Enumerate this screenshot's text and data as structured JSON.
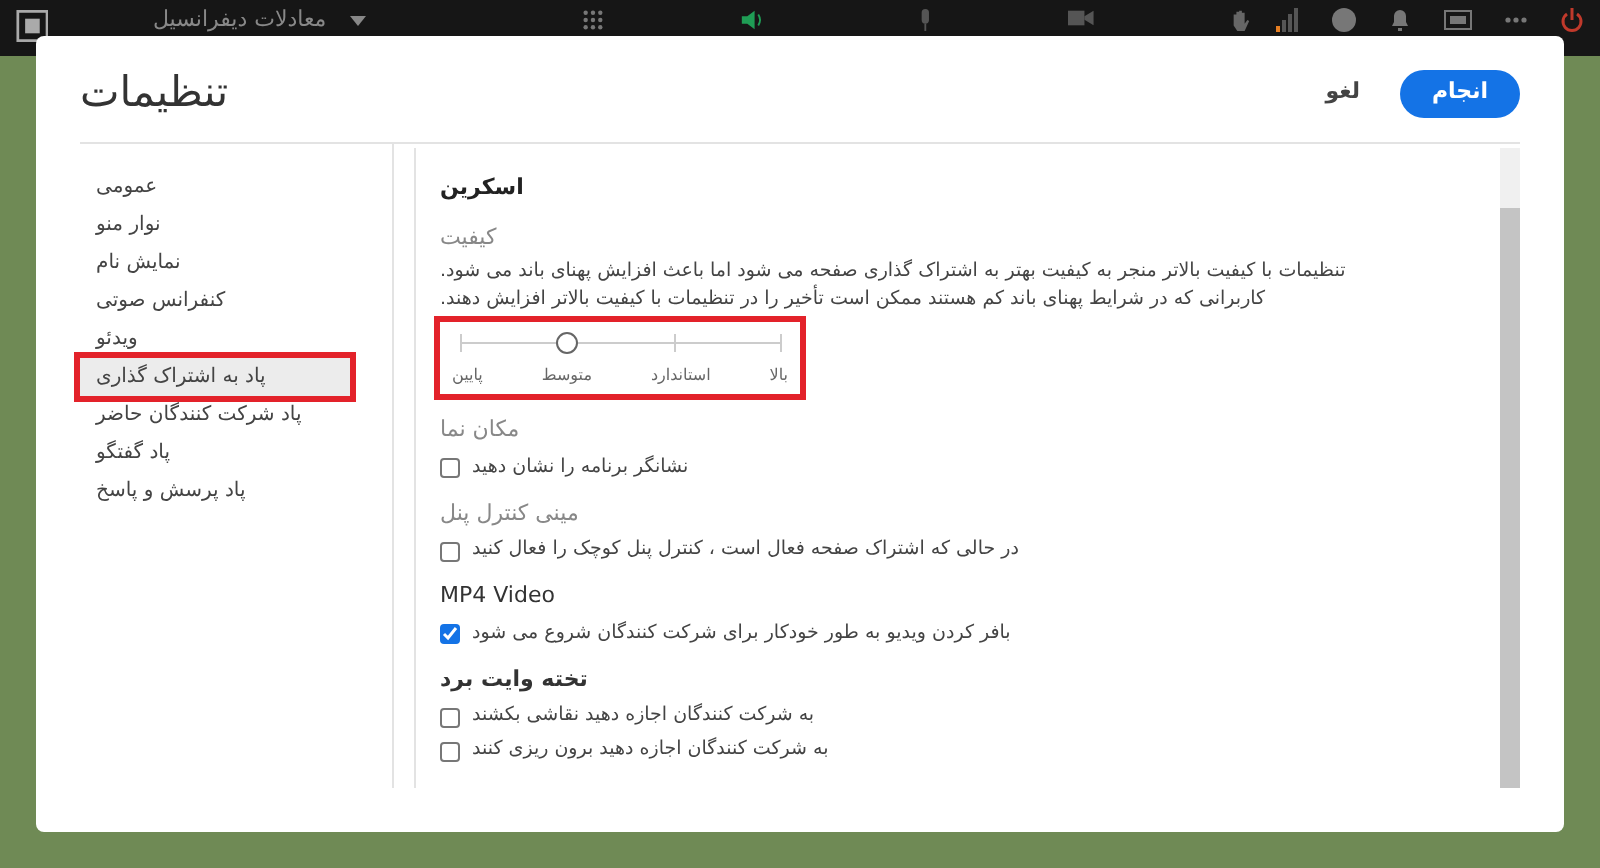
{
  "top_bar": {
    "meeting_title": "معادلات دیفرانسیل"
  },
  "dialog": {
    "title": "تنظیمات",
    "buttons": [
      {
        "label": "انجام",
        "kind": "primary"
      },
      {
        "label": "لغو",
        "kind": "plain"
      }
    ]
  },
  "sidebar": {
    "items": [
      {
        "label": "عمومی",
        "selected": false,
        "highlighted": false
      },
      {
        "label": "نوار منو",
        "selected": false,
        "highlighted": false
      },
      {
        "label": "نمایش نام",
        "selected": false,
        "highlighted": false
      },
      {
        "label": "کنفرانس صوتی",
        "selected": false,
        "highlighted": false
      },
      {
        "label": "ویدئو",
        "selected": false,
        "highlighted": false
      },
      {
        "label": "پاد به اشتراک گذاری",
        "selected": true,
        "highlighted": true
      },
      {
        "label": "پاد شرکت کنندگان حاضر",
        "selected": false,
        "highlighted": false
      },
      {
        "label": "پاد گفتگو",
        "selected": false,
        "highlighted": false
      },
      {
        "label": "پاد پرسش و پاسخ",
        "selected": false,
        "highlighted": false
      }
    ]
  },
  "content": {
    "heading": "اسکرین",
    "sections": [
      {
        "kind": "slider",
        "title": "کیفیت",
        "muted": true,
        "bold": false,
        "description": [
          "تنظیمات با کیفیت بالاتر منجر به کیفیت بهتر به اشتراک گذاری صفحه می شود اما باعث افزایش پهنای باند می شود.",
          "کاربرانی که در شرایط پهنای باند کم هستند ممکن است تأخیر را در تنظیمات با کیفیت بالاتر افزایش دهند."
        ],
        "slider": {
          "highlighted": true,
          "level": 0.333,
          "stops": [
            "بالا",
            "استاندارد",
            "متوسط",
            "پایین"
          ]
        }
      },
      {
        "kind": "checkboxes",
        "title": "مکان نما",
        "muted": true,
        "bold": false,
        "options": [
          {
            "label": "نشانگر برنامه را نشان دهید",
            "checked": false
          }
        ]
      },
      {
        "kind": "checkboxes",
        "title": "مینی کنترل پنل",
        "muted": true,
        "bold": false,
        "options": [
          {
            "label": "در حالی که اشتراک صفحه فعال است ، کنترل پنل کوچک را فعال کنید",
            "checked": false
          }
        ]
      },
      {
        "kind": "checkboxes",
        "title": "MP4 Video",
        "muted": false,
        "bold": false,
        "options": [
          {
            "label": "بافر کردن ویدیو به طور خودکار برای شرکت کنندگان شروع می شود",
            "checked": true
          }
        ]
      },
      {
        "kind": "checkboxes",
        "title": "تخته وایت برد",
        "muted": false,
        "bold": true,
        "options": [
          {
            "label": "به شرکت کنندگان اجازه دهید نقاشی بکشند",
            "checked": false
          },
          {
            "label": "به شرکت کنندگان اجازه دهید برون ریزی کنند",
            "checked": false
          }
        ]
      }
    ]
  }
}
